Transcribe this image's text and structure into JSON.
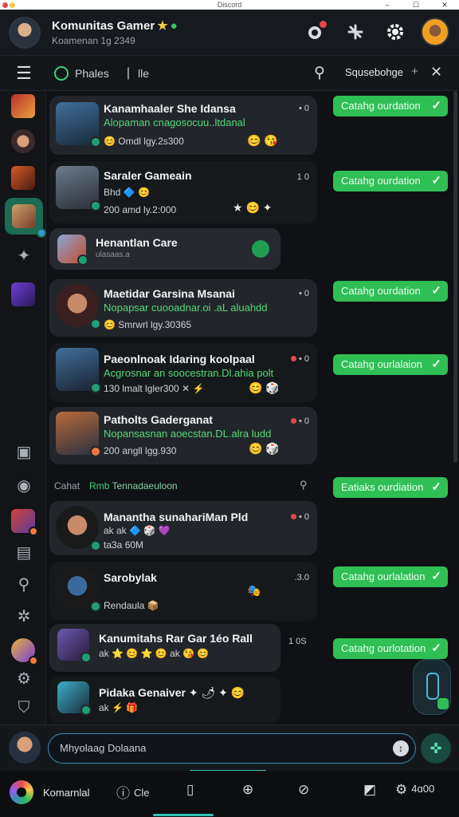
{
  "window": {
    "title": "Discord",
    "controls": [
      "–",
      "☐",
      "✕"
    ]
  },
  "header": {
    "title": "Komunitas Gamer",
    "title_star": "★",
    "title_gem": "●",
    "subtitle": "Koamenan 1g 2349",
    "actions": [
      "notification-icon",
      "share-icon",
      "gear-icon",
      "profile-avatar"
    ]
  },
  "toolbar": {
    "menu_glyph": "☰",
    "tab_label": "Phales",
    "tab_sep": "|",
    "tab2_label": "lle",
    "search_glyph": "⚲",
    "query": "Squsebohge",
    "plus": "+",
    "close": "✕"
  },
  "chats": [
    {
      "name": "Kanamhaaler She Idansa",
      "desc": "Alopaman cnagosocuu..ltdanal",
      "meta": "Omdl lgy.2s300",
      "time": "• 0",
      "reacts": "😊 😘",
      "pill": "Catahg ourdation"
    },
    {
      "name": "Saraler Gameain",
      "desc": "",
      "meta1": "Bhd 🔷 😊",
      "meta": "200 amd ly.2:000",
      "time": "1 0",
      "reacts": "★ 😊 ✦",
      "pill": "Catahg ourdation"
    },
    {
      "name": "Henantlan Care",
      "desc": "ulasaas.a",
      "meta": "",
      "time": "",
      "reacts": "",
      "pill": ""
    },
    {
      "name": "Maetidar Garsina Msanai",
      "desc": "Nopapsar cuooadnar.oi .aL aluahdd",
      "meta": "Smrwrl lgy.30365",
      "time": "• 0",
      "reacts": "",
      "pill": "Catahg ourdation"
    },
    {
      "name": "Paeonlnoak Idaring koolpaal",
      "desc": "Acgrosnar an soocestran.Dl.ahia polt",
      "meta": "130 lmalt lgler300 ✕  ⚡",
      "time": "• 0",
      "reacts": "😊 🎲",
      "pill": "Catahg ourlalaion"
    },
    {
      "name": "Patholts Gaderganat",
      "desc": "Nopansasnan aoecstan.DL.alra ludd",
      "meta": "200 angll lgg.930",
      "time": "• 0",
      "reacts": "😊 🎲",
      "pill": ""
    },
    {
      "name": "Manantha sunahariMan Pld",
      "desc": "",
      "meta1": "ak ak 🔷 🎲 💜",
      "meta": "ta3a 60M",
      "time": "• 0",
      "reacts": "",
      "pill": "Eatiaks ourdiation"
    },
    {
      "name": "Sarobylak",
      "desc": "",
      "meta": "Rendaula 📦",
      "time": ".3.0",
      "reacts": "🎭",
      "pill": "Catahg ourlalation"
    },
    {
      "name": "Kanumitahs Rar Gar 1éo Rall",
      "desc": "",
      "meta": "ak ⭐ 😊 ⭐ 😊 ak 😘 😊",
      "time": "1 0S",
      "reacts": "",
      "pill": "Catahg ourlotation"
    },
    {
      "name": "Pidaka Genaiver",
      "desc": "",
      "meta": "ak ⚡ 🎁",
      "time": "",
      "reacts": "✦ 🌶 ✦ 😊",
      "pill": ""
    }
  ],
  "pills_extra": [
    "Eatiaks ourdiation"
  ],
  "section": {
    "label": "Cahat",
    "accent": "Rmb",
    "rest": "Tennadaeuloon",
    "icon": "⚲"
  },
  "composer": {
    "placeholder": "Mhyolaag Dolaana",
    "input_icon": "↕",
    "send_glyph": "✜"
  },
  "bottomnav": {
    "brand": "Komarnlal",
    "items": [
      {
        "icon": "ⓘ",
        "label": "Cle"
      },
      {
        "icon": "▯",
        "label": ""
      },
      {
        "icon": "⊕",
        "label": ""
      },
      {
        "icon": "⊘",
        "label": ""
      },
      {
        "icon": "◩",
        "label": ""
      },
      {
        "icon": "⚙",
        "label": "4ɑ00"
      }
    ]
  }
}
